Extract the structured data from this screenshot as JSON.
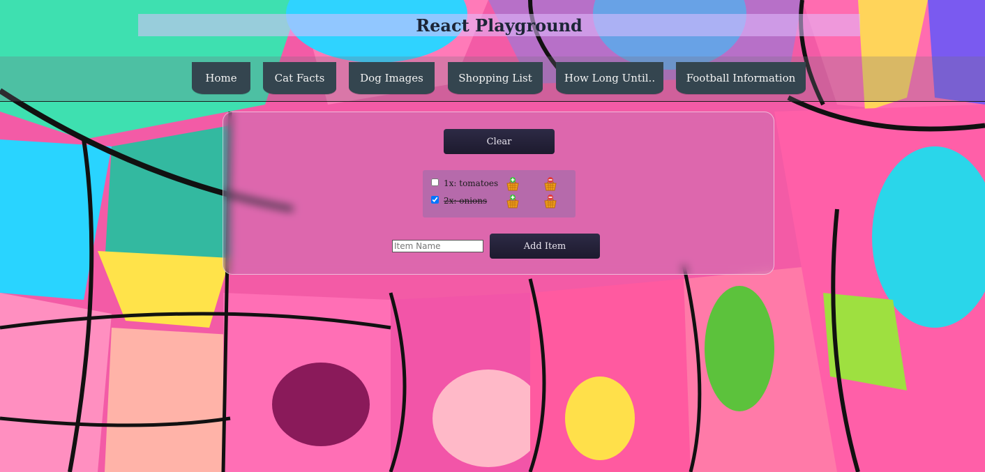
{
  "header": {
    "title": "React Playground"
  },
  "nav": {
    "items": [
      {
        "label": "Home"
      },
      {
        "label": "Cat Facts"
      },
      {
        "label": "Dog Images"
      },
      {
        "label": "Shopping List"
      },
      {
        "label": "How Long Until.."
      },
      {
        "label": "Football Information"
      }
    ]
  },
  "shopping": {
    "clear_label": "Clear",
    "items": [
      {
        "text": "1x: tomatoes",
        "checked": false,
        "add_icon": "basket-add-icon",
        "remove_icon": "basket-remove-icon"
      },
      {
        "text": "2x: onions",
        "checked": true,
        "add_icon": "basket-add-icon",
        "remove_icon": "basket-remove-icon"
      }
    ],
    "input_placeholder": "Item Name",
    "add_label": "Add Item"
  },
  "colors": {
    "nav_button": "#34454f",
    "action_button": "#221f35",
    "title_text": "#1c2536"
  }
}
